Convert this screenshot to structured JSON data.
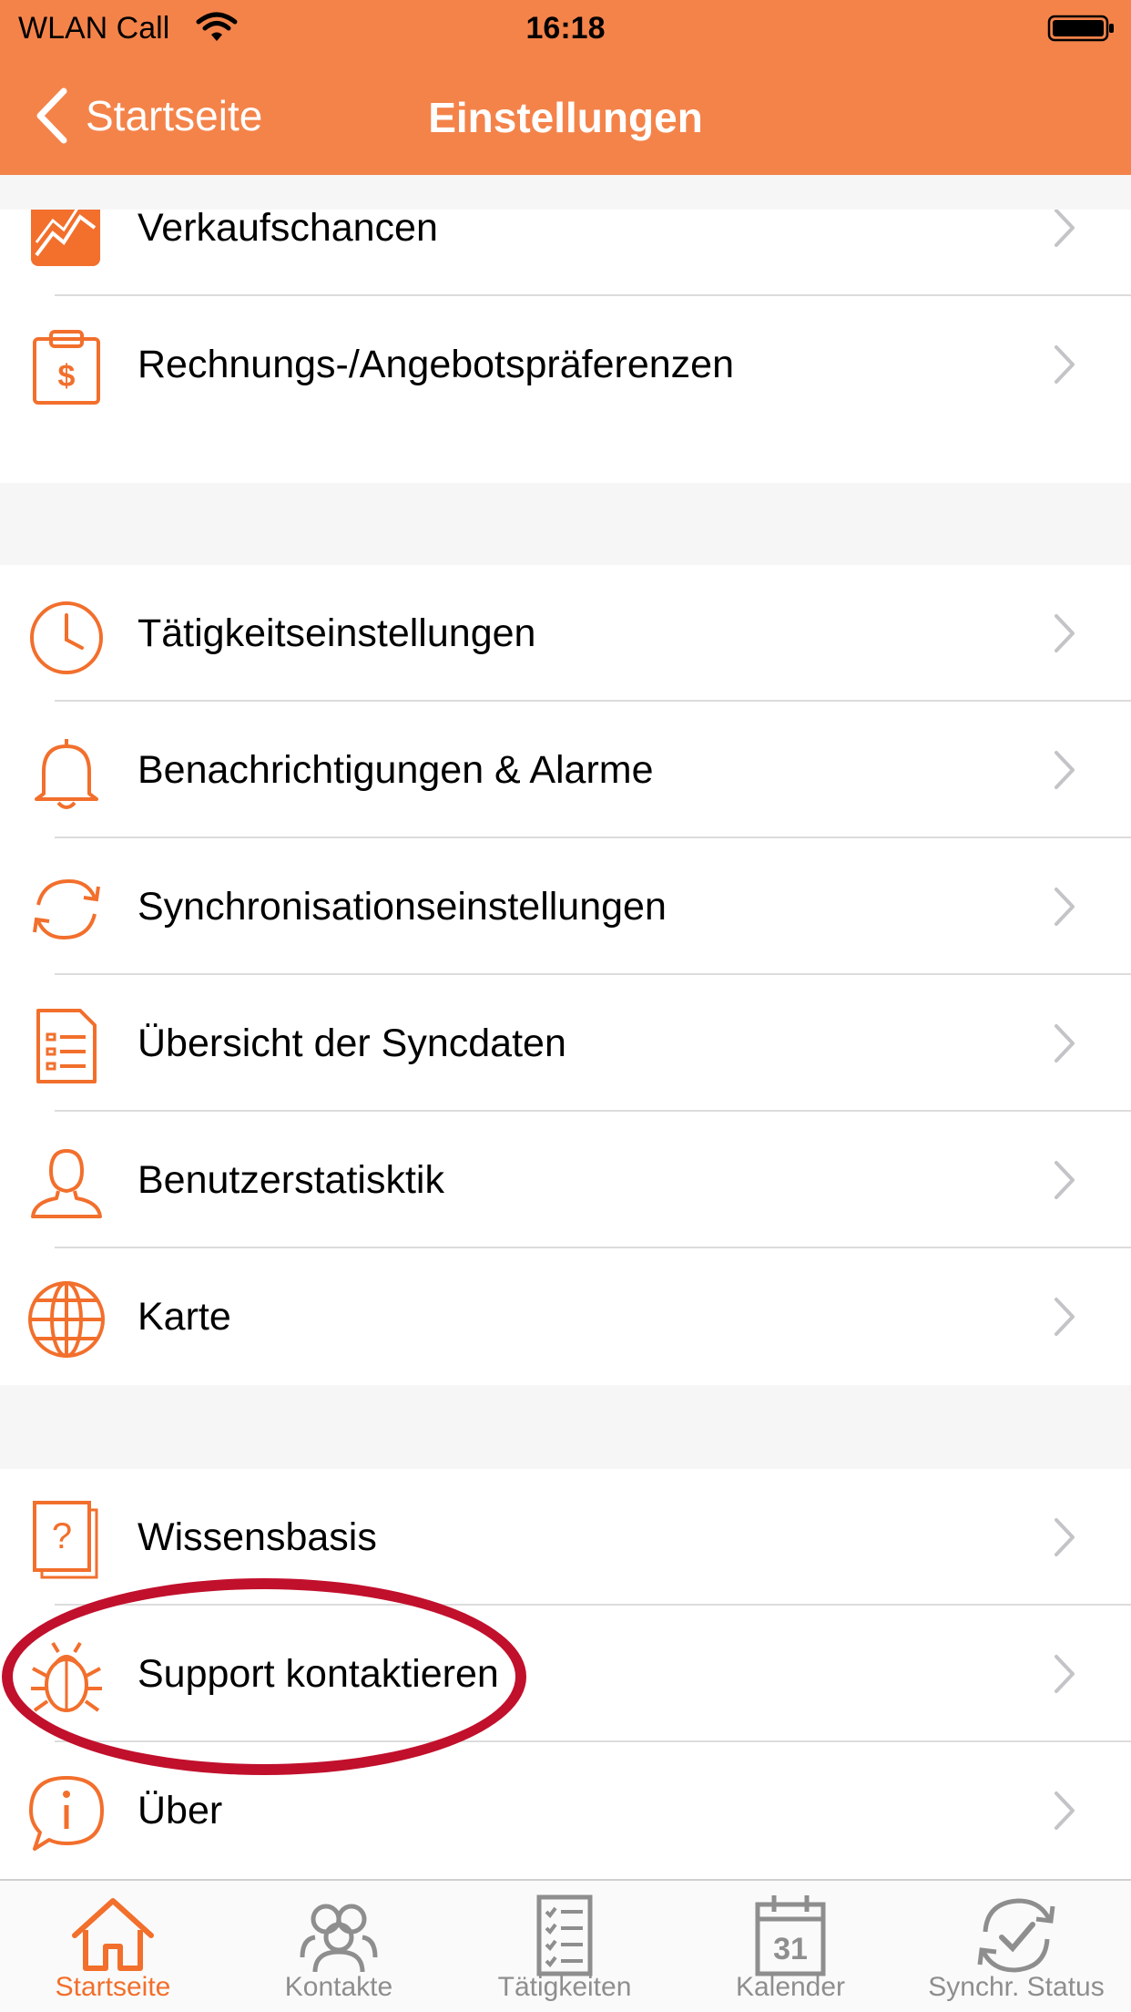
{
  "status_bar": {
    "carrier": "WLAN Call",
    "time": "16:18"
  },
  "nav": {
    "back_label": "Startseite",
    "title": "Einstellungen"
  },
  "groups": [
    {
      "items": [
        {
          "label": "Verkaufschancen",
          "icon": "chart-icon"
        },
        {
          "label": "Rechnungs-/Angebotspräferenzen",
          "icon": "clipboard-dollar-icon"
        }
      ]
    },
    {
      "items": [
        {
          "label": "Tätigkeitseinstellungen",
          "icon": "clock-icon"
        },
        {
          "label": "Benachrichtigungen & Alarme",
          "icon": "bell-icon"
        },
        {
          "label": "Synchronisationseinstellungen",
          "icon": "sync-icon"
        },
        {
          "label": "Übersicht der Syncdaten",
          "icon": "document-list-icon"
        },
        {
          "label": "Benutzerstatisktik",
          "icon": "user-icon"
        },
        {
          "label": "Karte",
          "icon": "globe-icon"
        }
      ]
    },
    {
      "items": [
        {
          "label": "Wissensbasis",
          "icon": "question-document-icon"
        },
        {
          "label": "Support kontaktieren",
          "icon": "bug-icon"
        },
        {
          "label": "Über",
          "icon": "info-bubble-icon"
        }
      ]
    }
  ],
  "tabs": [
    {
      "label": "Startseite",
      "icon": "home-icon",
      "active": true
    },
    {
      "label": "Kontakte",
      "icon": "contacts-icon",
      "active": false
    },
    {
      "label": "Tätigkeiten",
      "icon": "checklist-icon",
      "active": false
    },
    {
      "label": "Kalender",
      "icon": "calendar-icon",
      "active": false,
      "icon_text": "31"
    },
    {
      "label": "Synchr. Status",
      "icon": "sync-status-icon",
      "active": false
    }
  ],
  "colors": {
    "accent": "#f4834a",
    "icon_orange": "#f26f2c",
    "annotation": "#c1102c",
    "tab_inactive": "#8e8e8e"
  }
}
